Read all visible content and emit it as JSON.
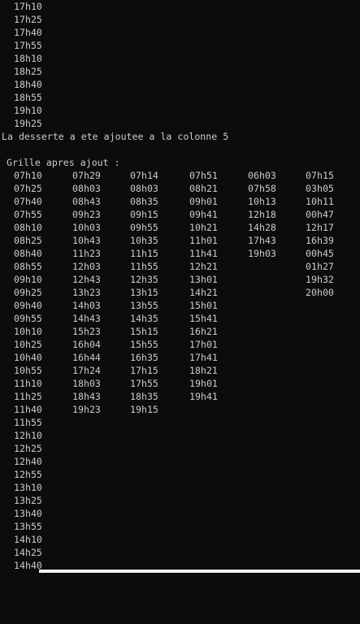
{
  "pre_lines": [
    "17h10",
    "17h25",
    "17h40",
    "17h55",
    "18h10",
    "18h25",
    "18h40",
    "18h55",
    "19h10",
    "19h25"
  ],
  "message": "La desserte a ete ajoutee a la colonne 5",
  "grid_header": "Grille apres ajout :",
  "grid": {
    "col0": [
      "07h10",
      "07h25",
      "07h40",
      "07h55",
      "08h10",
      "08h25",
      "08h40",
      "08h55",
      "09h10",
      "09h25",
      "09h40",
      "09h55",
      "10h10",
      "10h25",
      "10h40",
      "10h55",
      "11h10",
      "11h25",
      "11h40",
      "11h55",
      "12h10",
      "12h25",
      "12h40",
      "12h55",
      "13h10",
      "13h25",
      "13h40",
      "13h55",
      "14h10",
      "14h25",
      "14h40"
    ],
    "col1": [
      "07h29",
      "08h03",
      "08h43",
      "09h23",
      "10h03",
      "10h43",
      "11h23",
      "12h03",
      "12h43",
      "13h23",
      "14h03",
      "14h43",
      "15h23",
      "16h04",
      "16h44",
      "17h24",
      "18h03",
      "18h43",
      "19h23"
    ],
    "col2": [
      "07h14",
      "08h03",
      "08h35",
      "09h15",
      "09h55",
      "10h35",
      "11h15",
      "11h55",
      "12h35",
      "13h15",
      "13h55",
      "14h35",
      "15h15",
      "15h55",
      "16h35",
      "17h15",
      "17h55",
      "18h35",
      "19h15"
    ],
    "col3": [
      "07h51",
      "08h21",
      "09h01",
      "09h41",
      "10h21",
      "11h01",
      "11h41",
      "12h21",
      "13h01",
      "14h21",
      "15h01",
      "15h41",
      "16h21",
      "17h01",
      "17h41",
      "18h21",
      "19h01",
      "19h41"
    ],
    "col4": [
      "06h03",
      "07h58",
      "10h13",
      "12h18",
      "14h28",
      "17h43",
      "19h03"
    ],
    "col5": [
      "07h15",
      "03h05",
      "10h11",
      "00h47",
      "12h17",
      "16h39",
      "00h45",
      "01h27",
      "19h32",
      "20h00"
    ]
  }
}
